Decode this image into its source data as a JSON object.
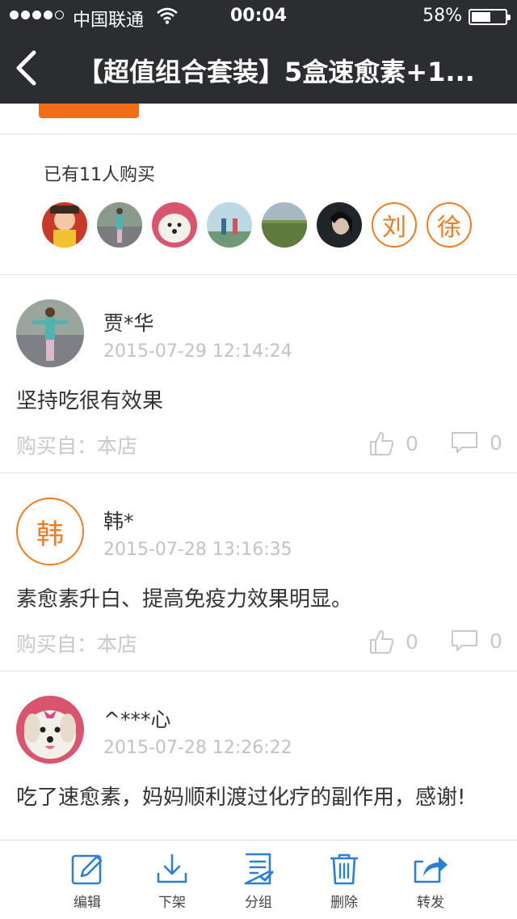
{
  "status_bar": {
    "carrier": "中国联通",
    "time": "00:04",
    "battery": "58%",
    "battery_level": 0.58
  },
  "nav": {
    "title": "【超值组合套装】5盒速愈素+1..."
  },
  "buyers": {
    "count_text": "已有11人购买",
    "letters": [
      "刘",
      "徐"
    ]
  },
  "reviews": [
    {
      "name": "贾*华",
      "time": "2015-07-29 12:14:24",
      "content": "坚持吃很有效果",
      "source": "购买自：本店",
      "likes": "0",
      "comments": "0"
    },
    {
      "name": "韩*",
      "avatar_letter": "韩",
      "time": "2015-07-28 13:16:35",
      "content": "素愈素升白、提高免疫力效果明显。",
      "source": "购买自：本店",
      "likes": "0",
      "comments": "0"
    },
    {
      "name": "^***心",
      "time": "2015-07-28 12:26:22",
      "content": "吃了速愈素，妈妈顺利渡过化疗的副作用，感谢!"
    }
  ],
  "toolbar": {
    "edit": "编辑",
    "unshelve": "下架",
    "group": "分组",
    "delete": "删除",
    "forward": "转发"
  },
  "colors": {
    "accent": "#f36d18",
    "nav_bg": "#2b2d30",
    "icon_blue": "#2d7fd3"
  }
}
